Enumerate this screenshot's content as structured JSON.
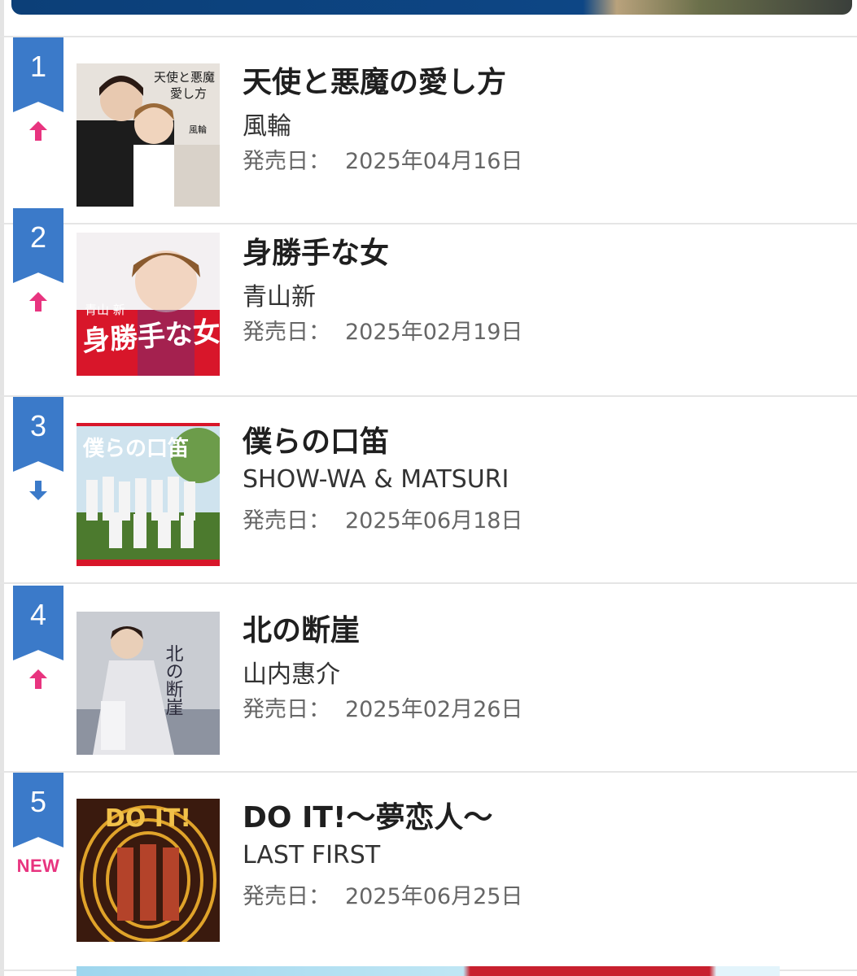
{
  "rankings": [
    {
      "rank": "1",
      "trend": "up",
      "title": "天使と悪魔の愛し方",
      "artist": "風輪",
      "release_label": "発売日：",
      "release_date": "2025年04月16日",
      "cover_text": [
        "天使と悪魔",
        "愛し方",
        "風輪"
      ],
      "colors": {
        "bg": "#e7e2dc",
        "accent": "#1c1c1c"
      }
    },
    {
      "rank": "2",
      "trend": "up",
      "title": "身勝手な女",
      "artist": "青山新",
      "release_label": "発売日：",
      "release_date": "2025年02月19日",
      "cover_text": [
        "青山 新",
        "身勝手な女"
      ],
      "colors": {
        "bg": "#d8162a",
        "accent": "#ffffff"
      }
    },
    {
      "rank": "3",
      "trend": "down",
      "title": "僕らの口笛",
      "artist": "SHOW-WA & MATSURI",
      "release_label": "発売日：",
      "release_date": "2025年06月18日",
      "cover_text": [
        "僕らの口笛"
      ],
      "colors": {
        "bg": "#9ec3d9",
        "accent": "#4c7a2e"
      }
    },
    {
      "rank": "4",
      "trend": "up",
      "title": "北の断崖",
      "artist": "山内惠介",
      "release_label": "発売日：",
      "release_date": "2025年02月26日",
      "cover_text": [
        "北の断崖"
      ],
      "colors": {
        "bg": "#c9ccd2",
        "accent": "#2a2a3a"
      }
    },
    {
      "rank": "5",
      "trend": "new",
      "trend_label": "NEW",
      "title": "DO IT!〜夢恋人〜",
      "artist": "LAST FIRST",
      "release_label": "発売日：",
      "release_date": "2025年06月25日",
      "cover_text": [
        "DO IT!"
      ],
      "colors": {
        "bg": "#3a1a0e",
        "accent": "#e0a32a"
      }
    }
  ],
  "colors": {
    "ribbon": "#3b7ac9",
    "trend_up": "#e8347f",
    "trend_down": "#3b7ac9",
    "divider": "#e5e5e5"
  }
}
